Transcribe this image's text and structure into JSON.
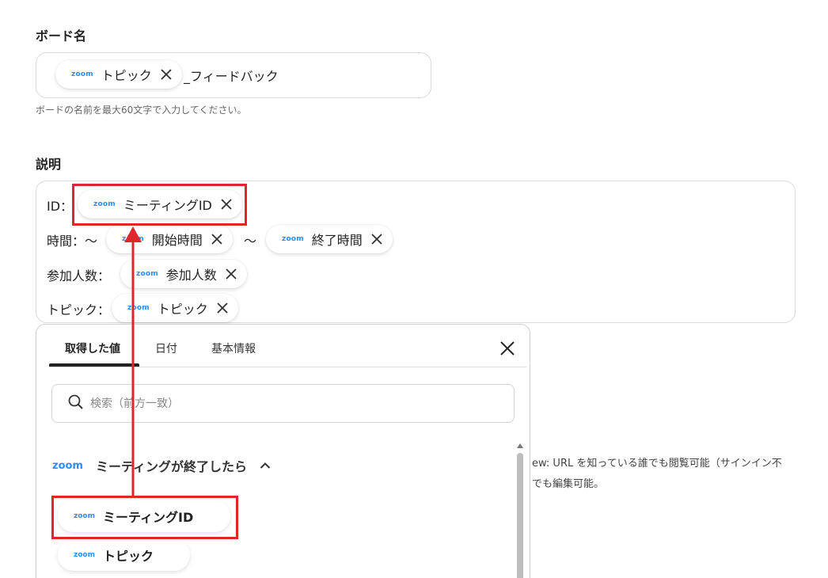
{
  "board_name": {
    "label": "ボード名",
    "token": {
      "service": "zoom",
      "text": "トピック"
    },
    "suffix": "_フィードバック",
    "hint": "ボードの名前を最大60文字で入力してください。"
  },
  "description": {
    "label": "説明",
    "rows": [
      {
        "label": "ID：",
        "tokens": [
          {
            "service": "zoom",
            "text": "ミーティングID"
          }
        ]
      },
      {
        "label": "時間：〜",
        "tokens": [
          {
            "service": "zoom",
            "text": "開始時間"
          },
          {
            "service": "zoom",
            "text": "終了時間"
          }
        ],
        "separator": "〜"
      },
      {
        "label": "参加人数：",
        "tokens": [
          {
            "service": "zoom",
            "text": "参加人数"
          }
        ]
      },
      {
        "label": "トピック：",
        "tokens": [
          {
            "service": "zoom",
            "text": "トピック"
          }
        ]
      }
    ]
  },
  "background_text": {
    "line1": "ew: URL を知っている誰でも閲覧可能（サインイン不",
    "line2": "でも編集可能。"
  },
  "picker": {
    "tabs": [
      {
        "label": "取得した値",
        "active": true
      },
      {
        "label": "日付",
        "active": false
      },
      {
        "label": "基本情報",
        "active": false
      }
    ],
    "search_placeholder": "検索（前方一致）",
    "section": {
      "service": "zoom",
      "title": "ミーティングが終了したら"
    },
    "options": [
      {
        "service": "zoom",
        "text": "ミーティングID",
        "highlighted": true
      },
      {
        "service": "zoom",
        "text": "トピック",
        "highlighted": false
      }
    ]
  },
  "colors": {
    "zoom_brand": "#2d8cff",
    "highlight": "#e0262c"
  }
}
